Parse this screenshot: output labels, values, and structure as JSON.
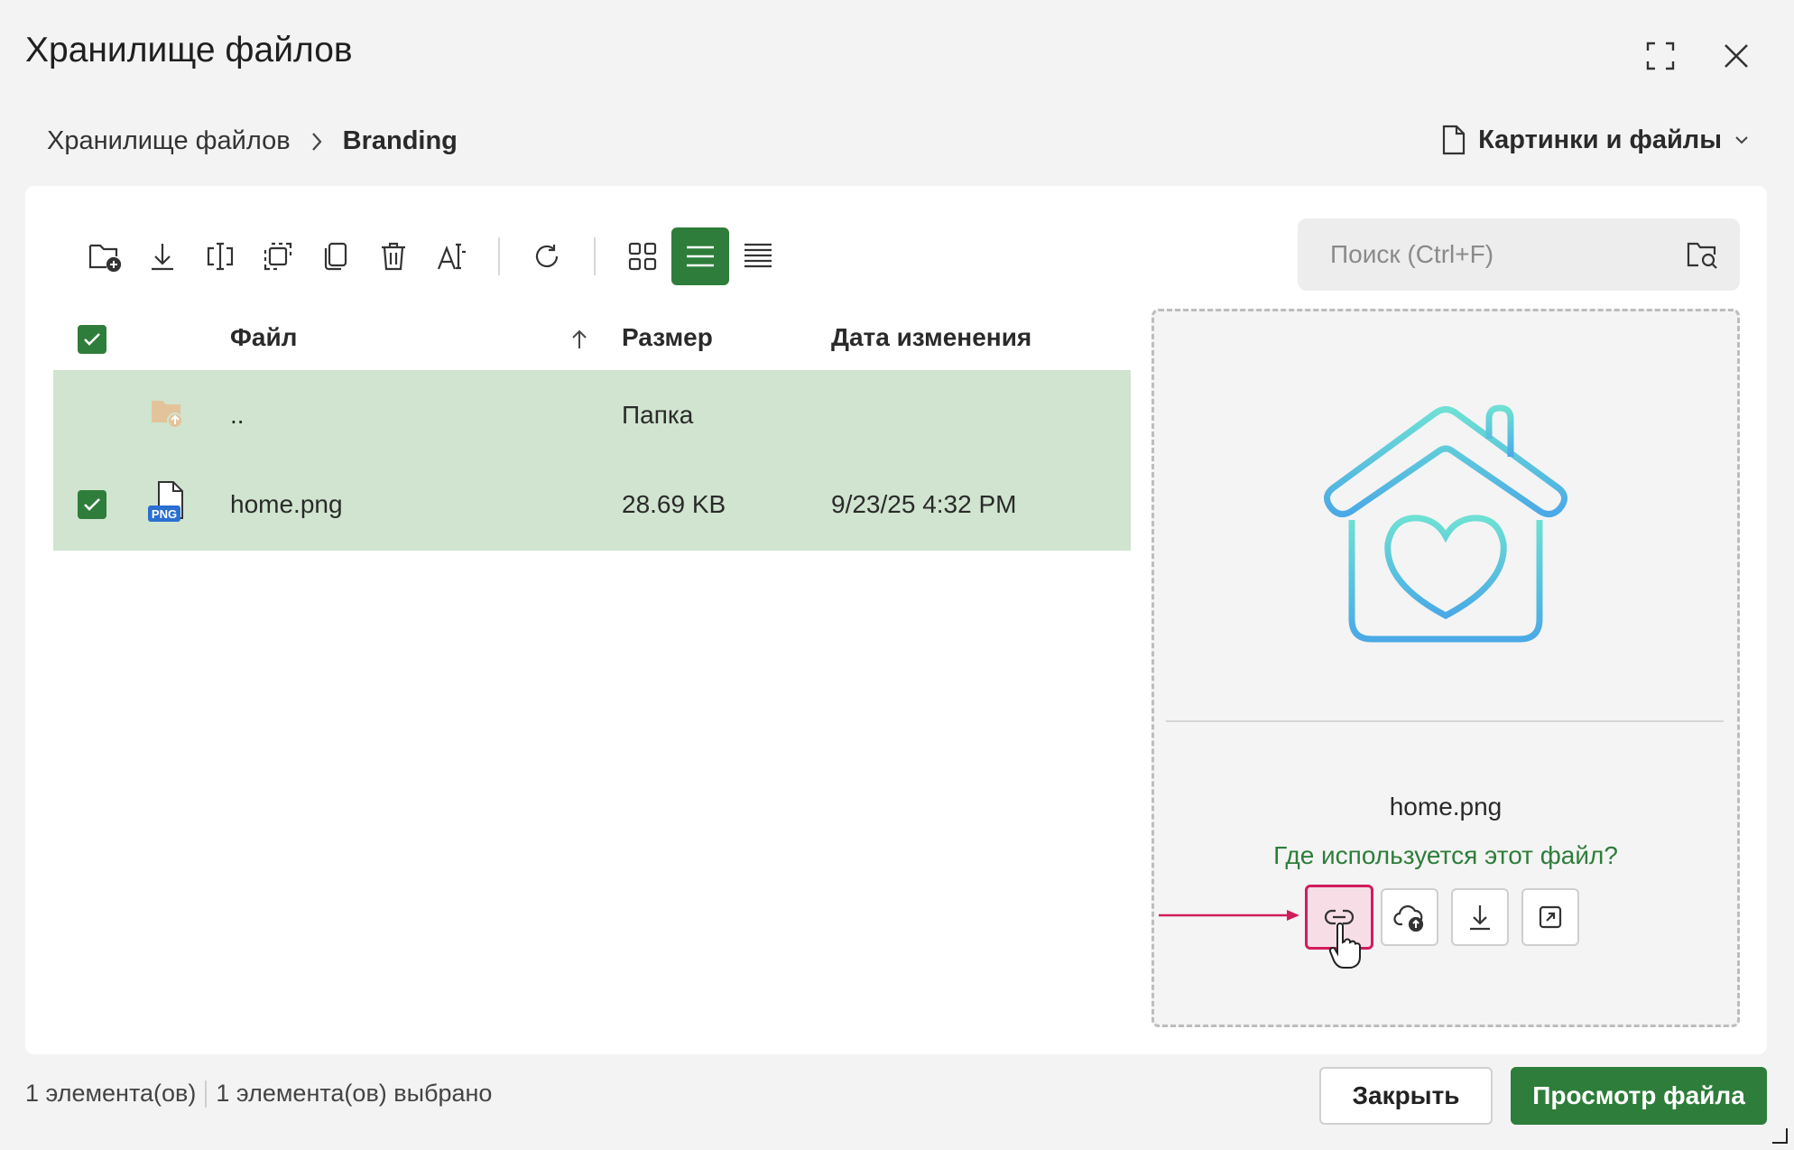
{
  "dialog": {
    "title": "Хранилище файлов"
  },
  "breadcrumb": {
    "root": "Хранилище файлов",
    "current": "Branding"
  },
  "type_filter": {
    "label": "Картинки и файлы"
  },
  "search": {
    "placeholder": "Поиск (Ctrl+F)"
  },
  "table": {
    "headers": {
      "file": "Файл",
      "size": "Размер",
      "modified": "Дата изменения"
    },
    "rows": [
      {
        "name": "..",
        "size": "Папка",
        "modified": ""
      },
      {
        "name": "home.png",
        "size": "28.69 KB",
        "modified": "9/23/25 4:32 PM",
        "badge": "PNG"
      }
    ]
  },
  "preview": {
    "filename": "home.png",
    "usage_link": "Где используется этот файл?"
  },
  "status": {
    "count": "1 элемента(ов)",
    "selected": "1 элемента(ов) выбрано"
  },
  "buttons": {
    "close": "Закрыть",
    "view_file": "Просмотр файла"
  },
  "colors": {
    "accent": "#2e7d3a",
    "row_selected": "#d0e4cf",
    "highlight": "#d11c5c"
  }
}
